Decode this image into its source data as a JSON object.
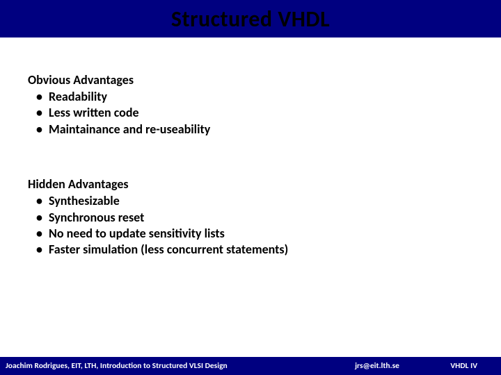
{
  "title": "Structured VHDL",
  "sections": [
    {
      "heading": "Obvious Advantages",
      "items": [
        "Readability",
        "Less written code",
        "Maintainance and re-useability"
      ]
    },
    {
      "heading": "Hidden Advantages",
      "items": [
        "Synthesizable",
        "Synchronous reset",
        "No need to update sensitivity lists",
        "Faster simulation (less concurrent statements)"
      ]
    }
  ],
  "footer": {
    "left": "Joachim Rodrigues, EIT, LTH, Introduction to Structured VLSI Design",
    "middle": "jrs@eit.lth.se",
    "right": "VHDL IV"
  }
}
